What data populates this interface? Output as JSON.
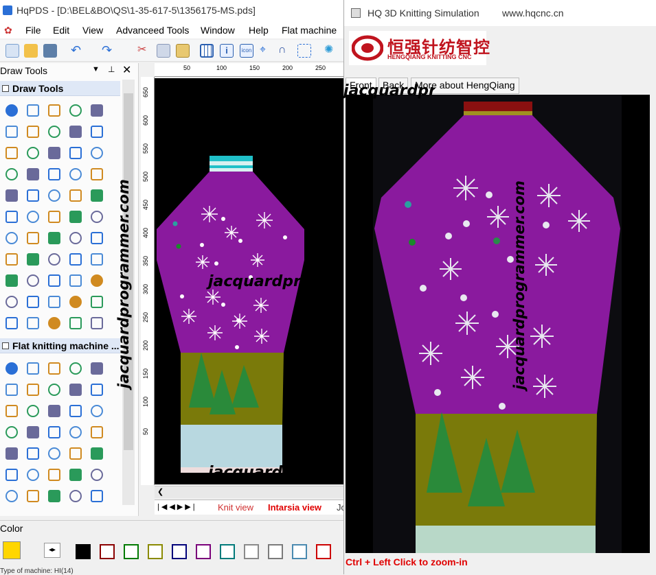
{
  "main_window": {
    "title": "HqPDS - [D:\\BEL&BO\\QS\\1-35-617-5\\1356175-MS.pds]"
  },
  "menu": [
    "File",
    "Edit",
    "View",
    "Advanceed Tools",
    "Window",
    "Help",
    "Flat machine"
  ],
  "draw_tools": {
    "panel_title": "Draw Tools",
    "section1": "Draw Tools",
    "section2": "Flat knitting machine ..."
  },
  "ruler_top": [
    "50",
    "100",
    "150",
    "200",
    "250"
  ],
  "ruler_left": [
    "650",
    "600",
    "550",
    "500",
    "450",
    "400",
    "350",
    "300",
    "250",
    "200",
    "150",
    "100",
    "50"
  ],
  "view_tabs": {
    "knit": "Knit view",
    "intarsia": "Intarsia view",
    "more": "Jc"
  },
  "color_bar": {
    "title": "Color",
    "status": "Type of machine: HI(14)",
    "colors": [
      "#000000",
      "#8b0000",
      "#007a00",
      "#8a8a00",
      "#00007a",
      "#7a007a",
      "#007a7a",
      "#8a8a8a",
      "#7a7a7a",
      "#4a8ab0",
      "#cc0000"
    ],
    "accent": "#ffd600"
  },
  "sim_window": {
    "title": "HQ 3D Knitting Simulation",
    "url": "www.hqcnc.cn",
    "logo_cn": "恒强针纺智控",
    "logo_en": "HENGQIANG KNITTING CNC",
    "tabs": [
      "Front",
      "Back",
      "More about HengQiang"
    ],
    "hint": "Ctrl + Left Click to zoom-in"
  },
  "watermark": "jacquardprogrammer.com",
  "garment_colors": {
    "body": "#8a1a9e",
    "lower": "#7a7a0a",
    "rib": "#b8d8e0",
    "tree": "#2a8a3a",
    "neck": "#20c0c8"
  }
}
